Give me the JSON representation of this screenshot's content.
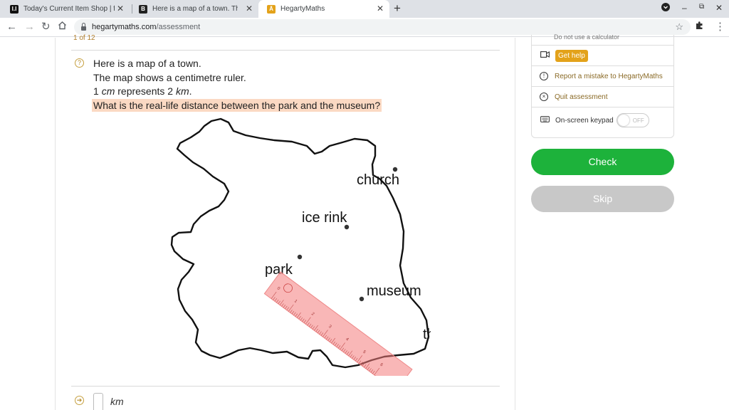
{
  "browser": {
    "tabs": [
      {
        "title": "Today's Current Item Shop | fnbr",
        "favicon": "fnbr-icon"
      },
      {
        "title": "Here is a map of a town. The ma",
        "favicon": "brainly-icon"
      },
      {
        "title": "HegartyMaths",
        "favicon": "hegarty-icon"
      }
    ],
    "url_host": "hegartymaths.com",
    "url_path": "/assessment"
  },
  "question": {
    "counter": "1 of 12",
    "line1": "Here is a map of a town.",
    "line2": "The map shows a centimetre ruler.",
    "line3_prefix": "1 ",
    "line3_unit1": "cm",
    "line3_mid": " represents 2 ",
    "line3_unit2": "km",
    "line3_suffix": ".",
    "highlight": "What is the real-life distance between the park and the museum?"
  },
  "map": {
    "labels": {
      "church": "church",
      "ice_rink": "ice rink",
      "park": "park",
      "museum": "museum",
      "theatre": "theatre"
    },
    "ruler_numbers": [
      "0",
      "1",
      "2",
      "3",
      "4",
      "5",
      "6"
    ]
  },
  "answer": {
    "unit": "km"
  },
  "tools": {
    "calculator_note": "Do not use a calculator",
    "get_help": "Get help",
    "report": "Report a mistake to HegartyMaths",
    "quit": "Quit assessment",
    "keypad_label": "On-screen keypad",
    "keypad_state": "OFF"
  },
  "buttons": {
    "check": "Check",
    "skip": "Skip"
  },
  "colors": {
    "check_green": "#1db23b",
    "skip_grey": "#c8c8c8",
    "get_help_orange": "#e3a21a",
    "highlight": "#fbd9c3"
  }
}
